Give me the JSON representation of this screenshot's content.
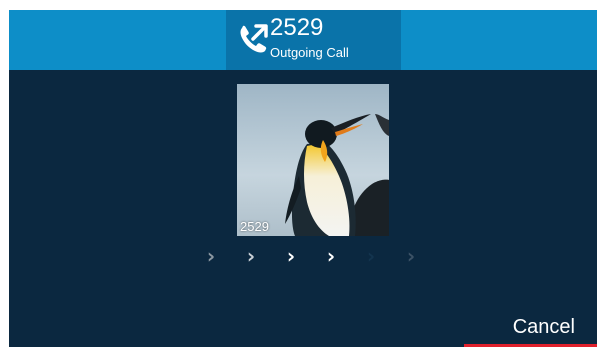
{
  "call": {
    "number": "2529",
    "status": "Outgoing Call",
    "icon": "outgoing-call-icon"
  },
  "contact": {
    "photo": "penguin-photo",
    "label": "2529"
  },
  "progress": {
    "total_steps": 6,
    "active_steps": 4,
    "icon": "chevron-right-icon"
  },
  "softkeys": {
    "cancel_label": "Cancel"
  },
  "colors": {
    "header": "#0d8ec8",
    "header_center": "#0a73a9",
    "background": "#0b2840",
    "cancel_accent": "#e0202c"
  }
}
